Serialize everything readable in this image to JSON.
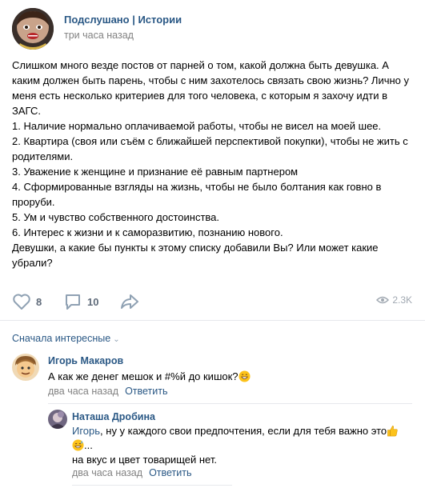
{
  "post": {
    "author": "Подслушано | Истории",
    "time": "три часа назад",
    "paragraphs": [
      "Слишком много везде постов от парней о том, какой должна быть девушка. А каким должен быть парень, чтобы с ним захотелось связать свою жизнь? Лично у меня есть несколько критериев для того человека, с которым я захочу идти в ЗАГС.",
      "1. Наличие нормально оплачиваемой работы, чтобы не висел на моей шее.",
      "2. Квартира (своя или съём с ближайшей перспективой покупки), чтобы не жить с родителями.",
      "3. Уважение к женщине и признание её равным партнером",
      "4. Сформированные взгляды на жизнь, чтобы не было болтания как говно в проруби.",
      "5. Ум и чувство собственного достоинства.",
      "6. Интерес к жизни и к саморазвитию, познанию нового.",
      "Девушки, а какие бы пункты к этому списку добавили Вы? Или может какие убрали?"
    ],
    "likes": "8",
    "comments_count": "10",
    "views": "2.3K"
  },
  "sort_label": "Сначала интересные",
  "comments": [
    {
      "author": "Игорь Макаров",
      "text": "А как же денег мешок и #%й до кишок?",
      "time": "два часа назад",
      "reply_label": "Ответить"
    },
    {
      "author": "Наташа Дробина",
      "mention": "Игорь",
      "text_line1": ", ну у каждого свои предпочтения, если для тебя важно это",
      "text_line2": "...",
      "text_line3": "на вкус и цвет товарищей нет.",
      "time": "два часа назад",
      "reply_label": "Ответить"
    }
  ],
  "colors": {
    "link": "#2a5885",
    "meta": "#828282",
    "icon": "#8fa1b3",
    "divider": "#e7e8ec"
  },
  "icons": [
    "heart-icon",
    "comment-icon",
    "share-icon",
    "eye-icon",
    "chevron-down-icon",
    "grin-emoji-icon",
    "thumbs-up-emoji-icon",
    "sweat-smile-emoji-icon"
  ]
}
